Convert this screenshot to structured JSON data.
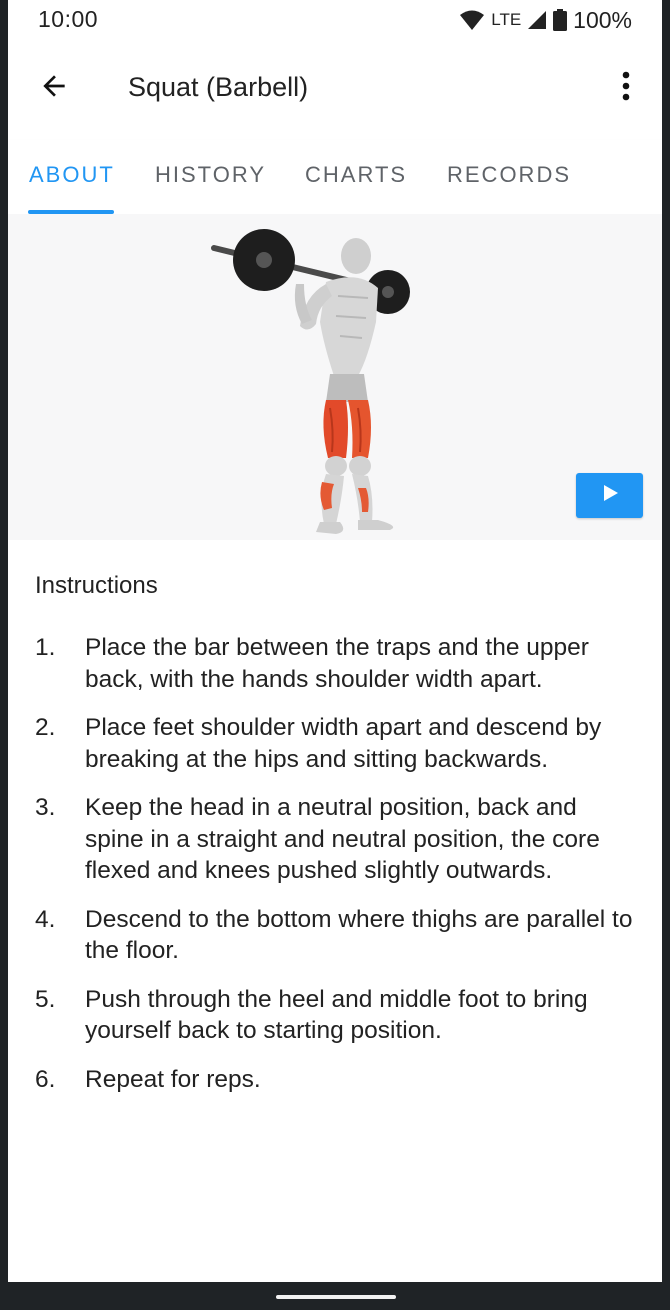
{
  "status_bar": {
    "time": "10:00",
    "network": "LTE",
    "battery": "100%"
  },
  "app_bar": {
    "title": "Squat (Barbell)",
    "back_icon": "arrow-back-icon",
    "menu_icon": "more-vert-icon"
  },
  "tabs": [
    {
      "label": "ABOUT",
      "active": true
    },
    {
      "label": "HISTORY",
      "active": false
    },
    {
      "label": "CHARTS",
      "active": false
    },
    {
      "label": "RECORDS",
      "active": false
    }
  ],
  "media": {
    "play_icon": "play-icon",
    "accent_color": "#2196f3"
  },
  "instructions": {
    "heading": "Instructions",
    "steps": [
      {
        "num": "1.",
        "text": "Place the bar between the traps and the upper back, with the hands shoulder width apart."
      },
      {
        "num": "2.",
        "text": "Place feet shoulder width apart and descend by breaking at the hips and sitting backwards."
      },
      {
        "num": "3.",
        "text": "Keep the head in a neutral position, back and spine in a straight and neutral position, the core flexed and knees pushed slightly outwards."
      },
      {
        "num": "4.",
        "text": "Descend to the bottom where thighs are parallel to the floor."
      },
      {
        "num": "5.",
        "text": "Push through the heel and middle foot to bring yourself back to starting position."
      },
      {
        "num": "6.",
        "text": "Repeat for reps."
      }
    ]
  }
}
